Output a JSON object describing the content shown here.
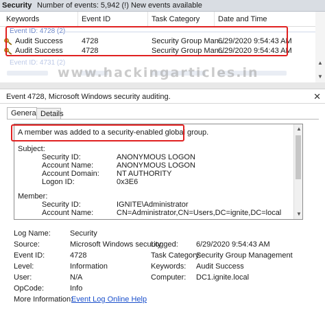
{
  "topbar": {
    "title": "Security",
    "count": "Number of events: 5,942 (!) New events available"
  },
  "grid": {
    "columns": [
      "Keywords",
      "Event ID",
      "Task Category",
      "Date and Time"
    ],
    "group_label": "Event ID: 4728 (2)",
    "rows": [
      {
        "keyword": "Audit Success",
        "event_id": "4728",
        "task": "Security Group Man...",
        "date": "6/29/2020 9:54:43 AM"
      },
      {
        "keyword": "Audit Success",
        "event_id": "4728",
        "task": "Security Group Man...",
        "date": "6/29/2020 9:54:43 AM"
      }
    ],
    "group2_label": "Event ID: 4731 (2)",
    "watermark": "www.hackingarticles.in"
  },
  "detail": {
    "header": "Event 4728, Microsoft Windows security auditing.",
    "close": "✕",
    "tabs": [
      "General",
      "Details"
    ],
    "message": {
      "line1": "A member was added to a security-enabled global group.",
      "subject_label": "Subject:",
      "subject": [
        {
          "k": "Security ID:",
          "v": "ANONYMOUS LOGON"
        },
        {
          "k": "Account Name:",
          "v": "ANONYMOUS LOGON"
        },
        {
          "k": "Account Domain:",
          "v": "NT AUTHORITY"
        },
        {
          "k": "Logon ID:",
          "v": "0x3E6"
        }
      ],
      "member_label": "Member:",
      "member": [
        {
          "k": "Security ID:",
          "v": "IGNITE\\Administrator"
        },
        {
          "k": "Account Name:",
          "v": "CN=Administrator,CN=Users,DC=ignite,DC=local"
        }
      ]
    },
    "props": {
      "log_name": {
        "k": "Log Name:",
        "v": "Security"
      },
      "source": {
        "k": "Source:",
        "v": "Microsoft Windows security"
      },
      "logged": {
        "k": "Logged:",
        "v": "6/29/2020 9:54:43 AM"
      },
      "event_id": {
        "k": "Event ID:",
        "v": "4728"
      },
      "task": {
        "k": "Task Category:",
        "v": "Security Group Management"
      },
      "level": {
        "k": "Level:",
        "v": "Information"
      },
      "keywords": {
        "k": "Keywords:",
        "v": "Audit Success"
      },
      "user": {
        "k": "User:",
        "v": "N/A"
      },
      "computer": {
        "k": "Computer:",
        "v": "DC1.ignite.local"
      },
      "opcode": {
        "k": "OpCode:",
        "v": "Info"
      },
      "more": {
        "k": "More Information:",
        "v": "Event Log Online Help"
      }
    }
  },
  "colors": {
    "highlight": "#e02020",
    "link": "#1a4fcc",
    "group": "#6b86c9"
  }
}
